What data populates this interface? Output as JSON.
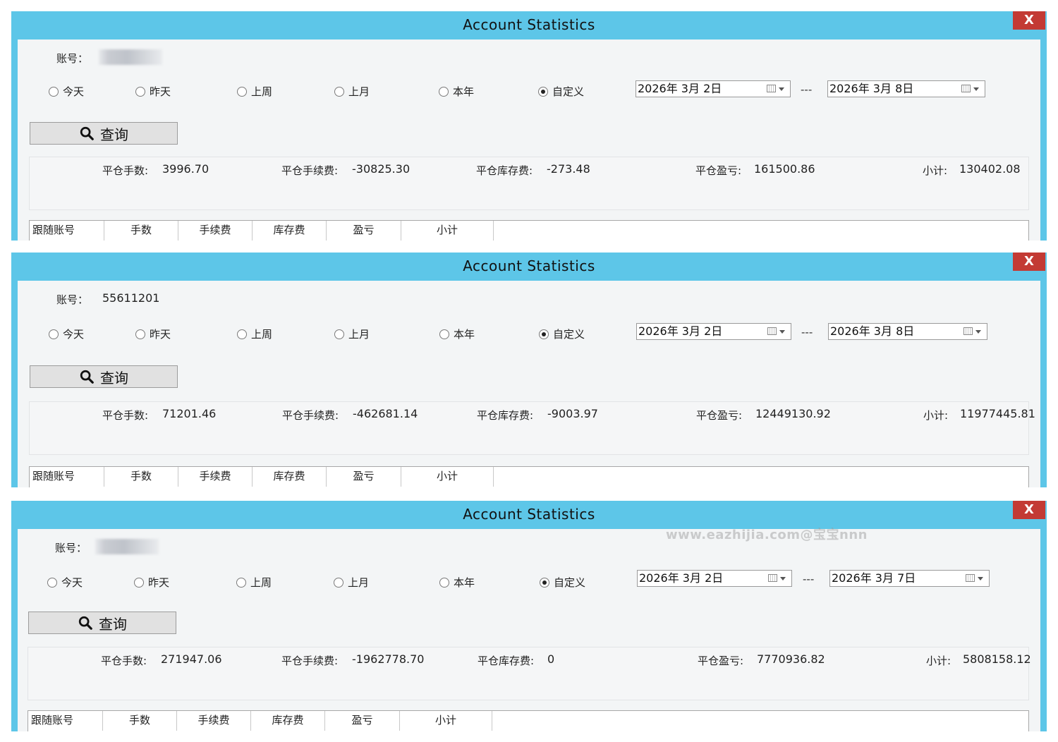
{
  "windows": [
    {
      "title": "Account Statistics",
      "close_glyph": "X",
      "account_label": "账号：",
      "account_value": "",
      "account_blurred": true,
      "radios": [
        {
          "label": "今天",
          "checked": false
        },
        {
          "label": "昨天",
          "checked": false
        },
        {
          "label": "上周",
          "checked": false
        },
        {
          "label": "上月",
          "checked": false
        },
        {
          "label": "本年",
          "checked": false
        },
        {
          "label": "自定义",
          "checked": true
        }
      ],
      "date_from": "2026年  3月  2日",
      "date_sep": "---",
      "date_to": "2026年  3月  8日",
      "query_label": "查询",
      "stats": {
        "lots_label": "平仓手数:",
        "lots_value": "3996.70",
        "fee_label": "平仓手续费:",
        "fee_value": "-30825.30",
        "swap_label": "平仓库存费:",
        "swap_value": "-273.48",
        "pnl_label": "平仓盈亏:",
        "pnl_value": "161500.86",
        "subtotal_label": "小计:",
        "subtotal_value": "130402.08"
      },
      "columns": [
        "跟随账号",
        "手数",
        "手续费",
        "库存费",
        "盈亏",
        "小计"
      ]
    },
    {
      "title": "Account Statistics",
      "close_glyph": "X",
      "account_label": "账号：",
      "account_value": "55611201",
      "account_blurred": false,
      "radios": [
        {
          "label": "今天",
          "checked": false
        },
        {
          "label": "昨天",
          "checked": false
        },
        {
          "label": "上周",
          "checked": false
        },
        {
          "label": "上月",
          "checked": false
        },
        {
          "label": "本年",
          "checked": false
        },
        {
          "label": "自定义",
          "checked": true
        }
      ],
      "date_from": "2026年  3月  2日",
      "date_sep": "---",
      "date_to": "2026年  3月  8日",
      "query_label": "查询",
      "stats": {
        "lots_label": "平仓手数:",
        "lots_value": "71201.46",
        "fee_label": "平仓手续费:",
        "fee_value": "-462681.14",
        "swap_label": "平仓库存费:",
        "swap_value": "-9003.97",
        "pnl_label": "平仓盈亏:",
        "pnl_value": "12449130.92",
        "subtotal_label": "小计:",
        "subtotal_value": "11977445.81"
      },
      "columns": [
        "跟随账号",
        "手数",
        "手续费",
        "库存费",
        "盈亏",
        "小计"
      ]
    },
    {
      "title": "Account Statistics",
      "close_glyph": "X",
      "account_label": "账号：",
      "account_value": "",
      "account_blurred": true,
      "radios": [
        {
          "label": "今天",
          "checked": false
        },
        {
          "label": "昨天",
          "checked": false
        },
        {
          "label": "上周",
          "checked": false
        },
        {
          "label": "上月",
          "checked": false
        },
        {
          "label": "本年",
          "checked": false
        },
        {
          "label": "自定义",
          "checked": true
        }
      ],
      "date_from": "2026年  3月  2日",
      "date_sep": "---",
      "date_to": "2026年  3月  7日",
      "query_label": "查询",
      "stats": {
        "lots_label": "平仓手数:",
        "lots_value": "271947.06",
        "fee_label": "平仓手续费:",
        "fee_value": "-1962778.70",
        "swap_label": "平仓库存费:",
        "swap_value": "0",
        "pnl_label": "平仓盈亏:",
        "pnl_value": "7770936.82",
        "subtotal_label": "小计:",
        "subtotal_value": "5808158.12"
      },
      "columns": [
        "跟随账号",
        "手数",
        "手续费",
        "库存费",
        "盈亏",
        "小计"
      ]
    }
  ],
  "watermark": "www.eazhijia.com@宝宝nnn",
  "colors": {
    "titlebar": "#5dc6e8",
    "close": "#c33a34",
    "client": "#f3f5f6"
  },
  "icons": {
    "close": "close-icon",
    "query": "search-icon",
    "date": "calendar-icon"
  }
}
